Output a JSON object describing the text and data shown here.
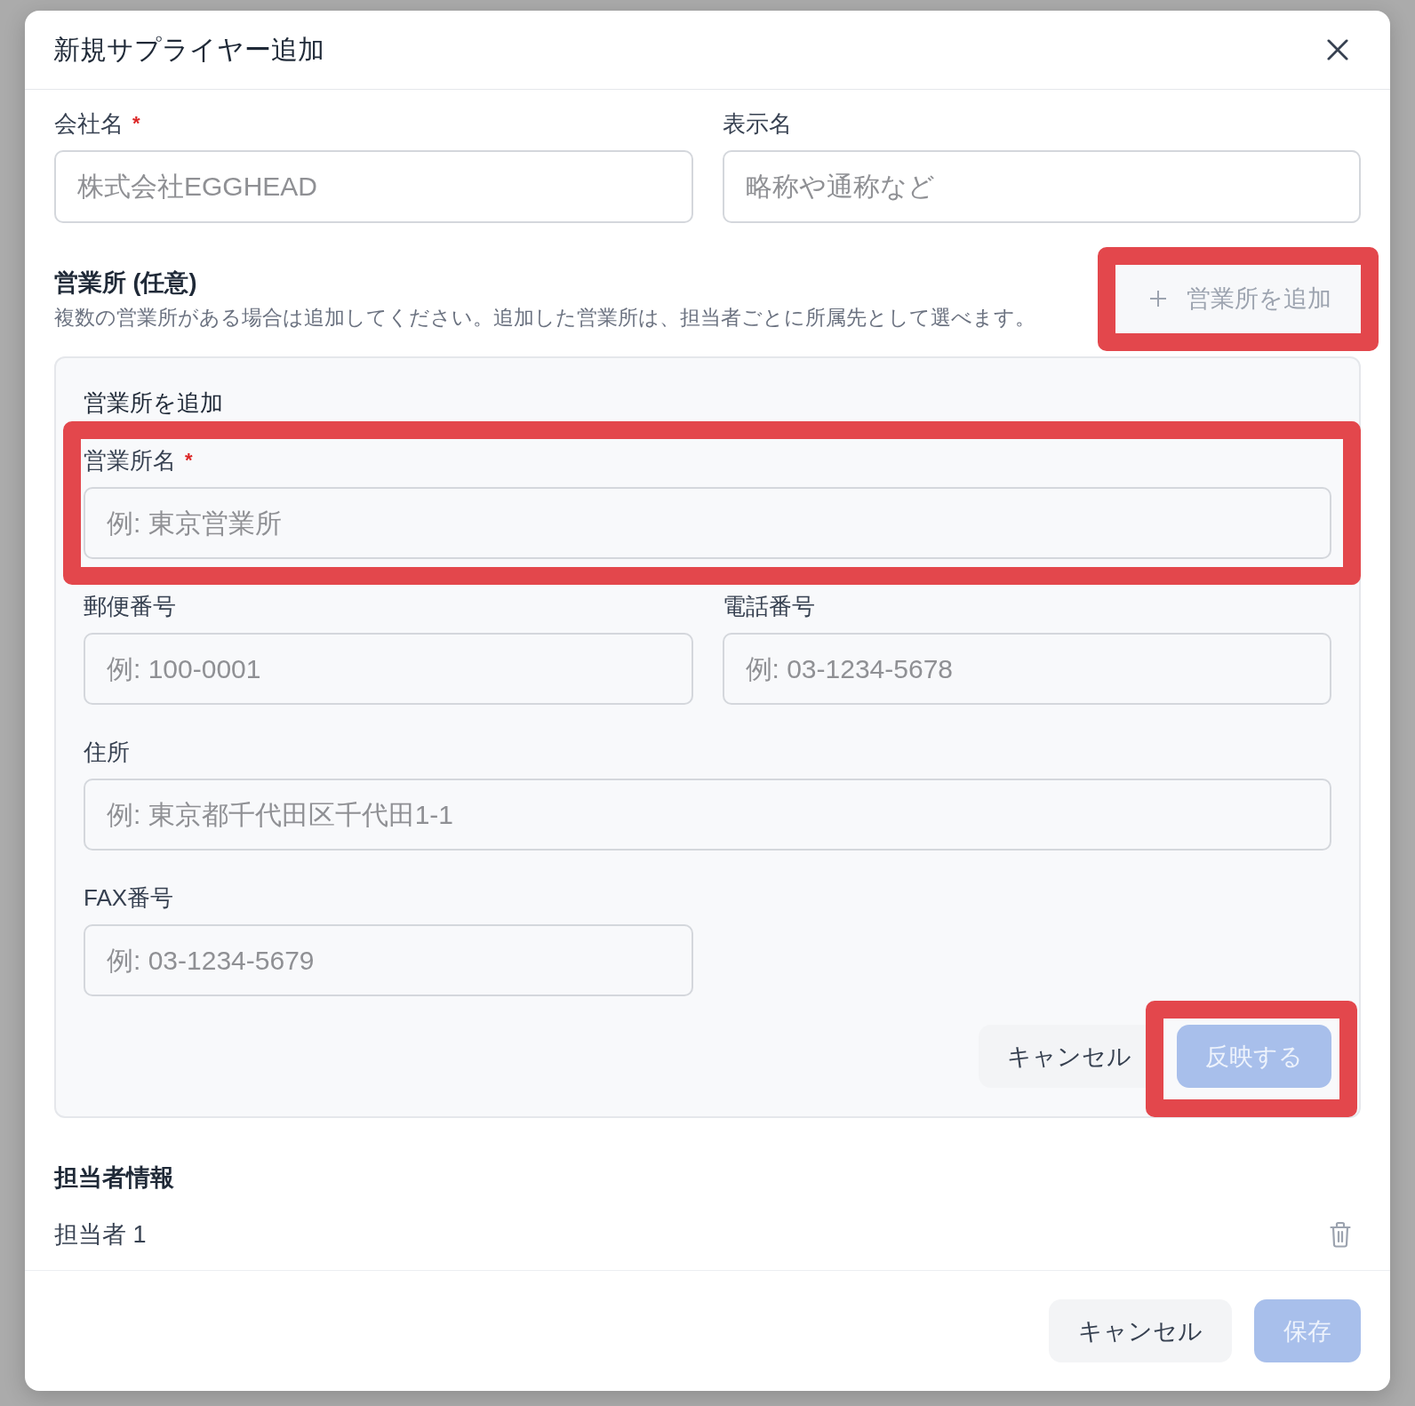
{
  "dialog": {
    "title": "新規サプライヤー追加"
  },
  "fields": [
    {
      "label": "会社名",
      "required_mark": "*",
      "placeholder": "株式会社EGGHEAD"
    },
    {
      "label": "表示名",
      "placeholder": "略称や通称など"
    }
  ],
  "branches": {
    "title": "営業所 (任意)",
    "description": "複数の営業所がある場合は追加してください。追加した営業所は、担当者ごとに所属先として選べます。",
    "add_button": {
      "label": "営業所を追加",
      "disabled": true,
      "highlighted": true
    },
    "form": {
      "title": "営業所を追加",
      "fields": [
        {
          "label": "営業所名",
          "required_mark": "*",
          "placeholder": "例: 東京営業所",
          "wide": true,
          "highlighted": true
        },
        {
          "label": "郵便番号",
          "placeholder": "例: 100-0001",
          "wide": false
        },
        {
          "label": "電話番号",
          "placeholder": "例: 03-1234-5678",
          "wide": false
        },
        {
          "label": "住所",
          "placeholder": "例: 東京都千代田区千代田1-1",
          "wide": true
        },
        {
          "label": "FAX番号",
          "placeholder": "例: 03-1234-5679",
          "wide": false
        }
      ],
      "buttons": [
        {
          "label": "キャンセル",
          "kind": "secondary",
          "disabled": false
        },
        {
          "label": "反映する",
          "kind": "primary",
          "disabled": true,
          "highlighted": true
        }
      ]
    }
  },
  "contacts": {
    "title": "担当者情報",
    "items": [
      {
        "label": "担当者 1"
      }
    ]
  },
  "footer": {
    "buttons": [
      {
        "label": "キャンセル",
        "kind": "secondary",
        "disabled": false
      },
      {
        "label": "保存",
        "kind": "primary",
        "disabled": true
      }
    ]
  }
}
